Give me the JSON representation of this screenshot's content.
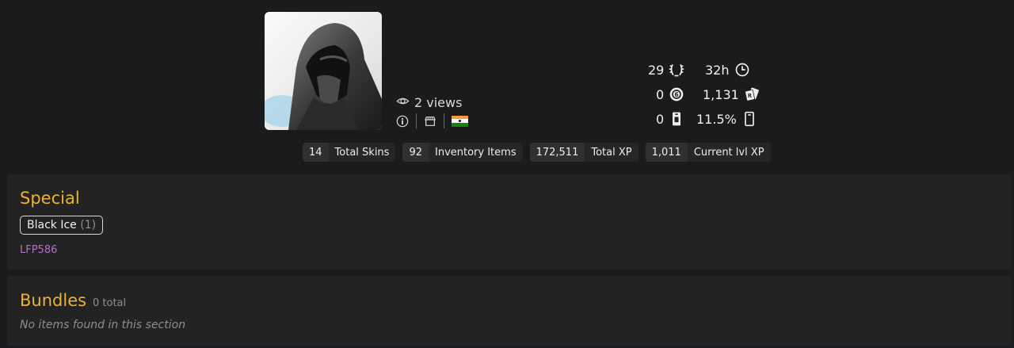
{
  "profile": {
    "views": "2 views"
  },
  "stats": {
    "level": "29",
    "playtime": "32h",
    "currency_r6": "0",
    "renown": "1,131",
    "alpha_packs": "0",
    "alpha_pack_chance": "11.5%"
  },
  "chips": [
    {
      "num": "14",
      "label": "Total Skins"
    },
    {
      "num": "92",
      "label": "Inventory Items"
    },
    {
      "num": "172,511",
      "label": "Total XP"
    },
    {
      "num": "1,011",
      "label": "Current lvl XP"
    }
  ],
  "special": {
    "title": "Special",
    "badge_label": "Black Ice",
    "badge_count": "(1)",
    "code": "LFP586"
  },
  "bundles": {
    "title": "Bundles",
    "total": "0 total",
    "empty_text": "No items found in this section"
  },
  "colors": {
    "accent": "#eab330",
    "code_purple": "#b36fcc",
    "background": "#191b1c",
    "panel": "#232324"
  },
  "icons": {
    "views": "eye-icon",
    "level": "laurel-icon",
    "playtime": "clock-icon",
    "currency": "r6-credits-icon",
    "renown": "renown-icon",
    "alpha_packs": "alpha-pack-icon",
    "alpha_pack_chance": "alpha-pack-chance-icon"
  }
}
